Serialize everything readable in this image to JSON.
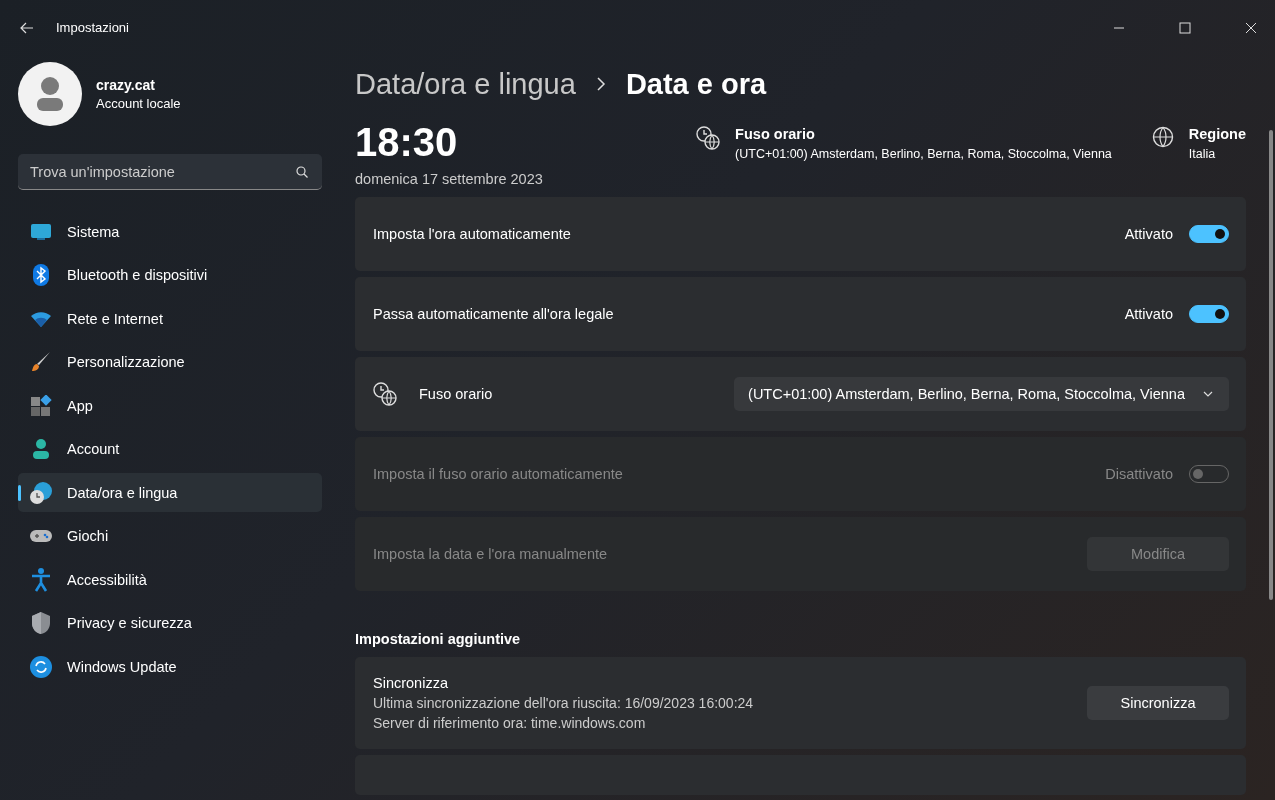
{
  "window": {
    "title": "Impostazioni"
  },
  "user": {
    "name": "crazy.cat",
    "subtitle": "Account locale"
  },
  "search": {
    "placeholder": "Trova un'impostazione"
  },
  "nav": [
    {
      "label": "Sistema",
      "kind": "display",
      "selected": false
    },
    {
      "label": "Bluetooth e dispositivi",
      "kind": "bluetooth",
      "selected": false
    },
    {
      "label": "Rete e Internet",
      "kind": "wifi",
      "selected": false
    },
    {
      "label": "Personalizzazione",
      "kind": "brush",
      "selected": false
    },
    {
      "label": "App",
      "kind": "apps",
      "selected": false
    },
    {
      "label": "Account",
      "kind": "person",
      "selected": false
    },
    {
      "label": "Data/ora e lingua",
      "kind": "globe-clock",
      "selected": true
    },
    {
      "label": "Giochi",
      "kind": "gamepad",
      "selected": false
    },
    {
      "label": "Accessibilità",
      "kind": "accessibility",
      "selected": false
    },
    {
      "label": "Privacy e sicurezza",
      "kind": "shield",
      "selected": false
    },
    {
      "label": "Windows Update",
      "kind": "update",
      "selected": false
    }
  ],
  "breadcrumb": {
    "parent": "Data/ora e lingua",
    "current": "Data e ora"
  },
  "clock": {
    "time": "18:30",
    "date": "domenica 17 settembre 2023"
  },
  "info": [
    {
      "kind": "timezone",
      "title": "Fuso orario",
      "value": "(UTC+01:00) Amsterdam, Berlino, Berna, Roma, Stoccolma, Vienna"
    },
    {
      "kind": "region",
      "title": "Regione",
      "value": "Italia"
    }
  ],
  "settings": [
    {
      "kind": "toggle",
      "label": "Imposta l'ora automaticamente",
      "state_text": "Attivato",
      "on": true,
      "disabled": false
    },
    {
      "kind": "toggle",
      "label": "Passa automaticamente all'ora legale",
      "state_text": "Attivato",
      "on": true,
      "disabled": false
    },
    {
      "kind": "dropdown",
      "label": "Fuso orario",
      "value": "(UTC+01:00) Amsterdam, Berlino, Berna, Roma, Stoccolma, Vienna",
      "disabled": false
    },
    {
      "kind": "toggle",
      "label": "Imposta il fuso orario automaticamente",
      "state_text": "Disattivato",
      "on": false,
      "disabled": true
    },
    {
      "kind": "button",
      "label": "Imposta la data e l'ora manualmente",
      "button": "Modifica",
      "disabled": true
    }
  ],
  "additional": {
    "title": "Impostazioni aggiuntive",
    "sync": {
      "title": "Sincronizza",
      "lines": [
        "Ultima sincronizzazione dell'ora riuscita: 16/09/2023 16:00:24",
        "Server di riferimento ora: time.windows.com"
      ],
      "button": "Sincronizza"
    }
  }
}
